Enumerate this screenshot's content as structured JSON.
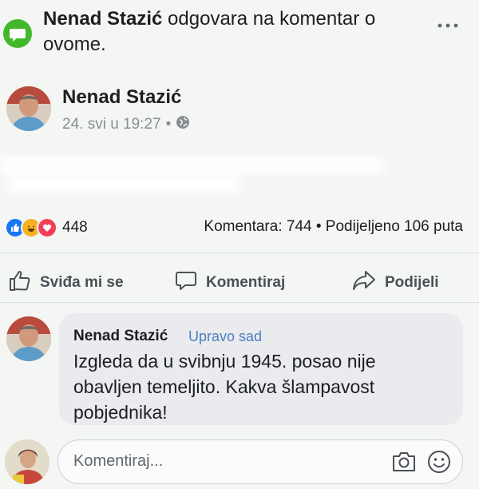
{
  "notification": {
    "actor": "Nenad Stazić",
    "text": " odgovara na komentar o ovome."
  },
  "post": {
    "author": "Nenad Stazić",
    "timestamp": "24. svi u 19:27",
    "privacy_separator": "•",
    "reaction_count": "448",
    "stats": "Komentara: 744 • Podijeljeno 106 puta"
  },
  "actions": {
    "like": "Sviđa mi se",
    "comment": "Komentiraj",
    "share": "Podijeli"
  },
  "comment": {
    "author": "Nenad Stazić",
    "time": "Upravo sad",
    "text": "Izgleda da u svibnju 1945. posao nije obavljen temeljito. Kakva šlampavost pobjednika!"
  },
  "composer": {
    "placeholder": "Komentiraj..."
  },
  "colors": {
    "background": "#f4f6f4",
    "notif_green": "#42b72a",
    "like_blue": "#1877f2",
    "love_red": "#f33e58",
    "haha_yellow": "#f7b125",
    "link_blue": "#4e7dc1"
  },
  "icons": {
    "notification": "comment-bubble-icon",
    "more": "more-icon",
    "privacy": "globe-icon",
    "like": "thumbs-up-icon",
    "comment": "speech-bubble-icon",
    "share": "share-arrow-icon",
    "camera": "camera-icon",
    "emoji": "smiley-icon"
  }
}
